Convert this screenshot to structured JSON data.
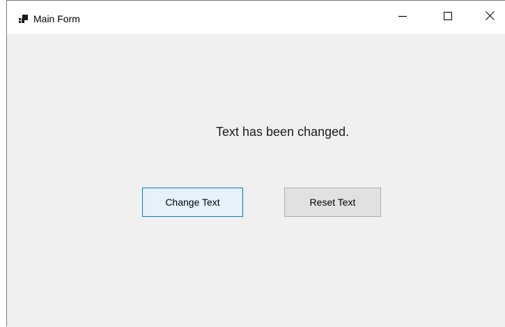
{
  "window": {
    "title": "Main Form",
    "icon": "app-window-icon",
    "caption_buttons": [
      "minimize-icon",
      "maximize-icon",
      "close-icon"
    ]
  },
  "form": {
    "message": "Text has been changed.",
    "buttons": {
      "change_label": "Change Text",
      "reset_label": "Reset Text"
    }
  },
  "colors": {
    "client_background": "#f0f0f0",
    "focused_button_bg": "#e5f1fb",
    "focused_button_border": "#0078d7",
    "button_bg": "#e1e1e1",
    "button_border": "#adadad"
  }
}
